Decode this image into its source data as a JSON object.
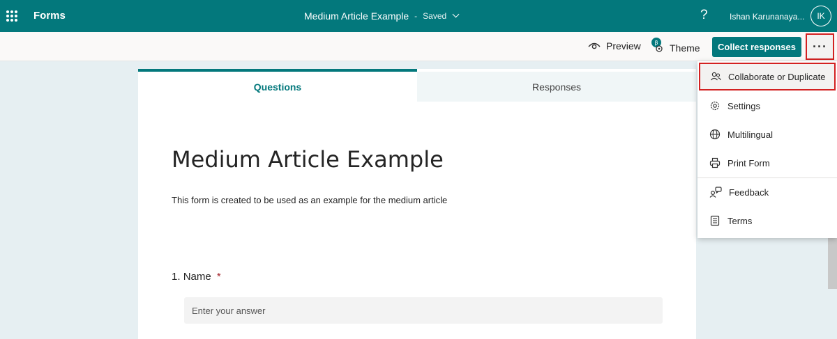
{
  "topbar": {
    "app_name": "Forms",
    "doc_title": "Medium Article Example",
    "separator": "-",
    "save_status": "Saved",
    "help": "?",
    "user_name": "Ishan Karunanaya...",
    "avatar_initials": "IK",
    "bg_color": "#03787c"
  },
  "commandbar": {
    "preview_label": "Preview",
    "theme_label": "Theme",
    "collect_label": "Collect responses",
    "more_label": "···"
  },
  "tabs": [
    {
      "label": "Questions",
      "active": true
    },
    {
      "label": "Responses",
      "active": false
    }
  ],
  "form": {
    "title": "Medium Article Example",
    "description": "This form is created to be used as an example for the medium article",
    "questions": [
      {
        "number": "1.",
        "label": "Name",
        "required_mark": "*",
        "placeholder": "Enter your answer"
      }
    ]
  },
  "menu": {
    "items": [
      {
        "label": "Collaborate or Duplicate",
        "icon": "people-icon",
        "highlighted": true
      },
      {
        "label": "Settings",
        "icon": "gear-icon"
      },
      {
        "label": "Multilingual",
        "icon": "globe-icon"
      },
      {
        "label": "Print Form",
        "icon": "printer-icon"
      },
      {
        "label": "Feedback",
        "icon": "feedback-icon"
      },
      {
        "label": "Terms",
        "icon": "document-icon"
      }
    ]
  },
  "colors": {
    "accent": "#03787c",
    "highlight_border": "#d32121",
    "required": "#a4262c"
  }
}
